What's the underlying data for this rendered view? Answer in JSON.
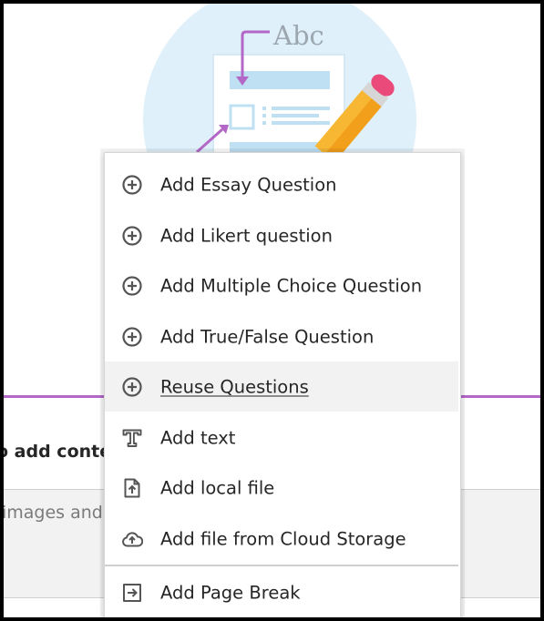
{
  "illustration": {
    "caption_text": "Abc"
  },
  "background": {
    "label": "o add conte",
    "input_placeholder": "images and"
  },
  "menu": {
    "items": [
      {
        "label": "Add Essay Question",
        "icon": "plus-circle-icon"
      },
      {
        "label": "Add Likert question",
        "icon": "plus-circle-icon"
      },
      {
        "label": "Add Multiple Choice Question",
        "icon": "plus-circle-icon"
      },
      {
        "label": "Add True/False Question",
        "icon": "plus-circle-icon"
      },
      {
        "label": "Reuse Questions",
        "icon": "plus-circle-icon",
        "state": "hovered"
      },
      {
        "label": "Add text",
        "icon": "text-icon"
      },
      {
        "label": "Add local file",
        "icon": "upload-file-icon"
      },
      {
        "label": "Add file from Cloud Storage",
        "icon": "cloud-upload-icon"
      },
      {
        "label": "Add Page Break",
        "icon": "page-break-icon"
      }
    ]
  },
  "colors": {
    "accent_purple": "#b368c7",
    "illustration_blue": "#dff0fa",
    "pencil_yellow": "#f7b733",
    "pencil_pink": "#ea4a7a"
  }
}
